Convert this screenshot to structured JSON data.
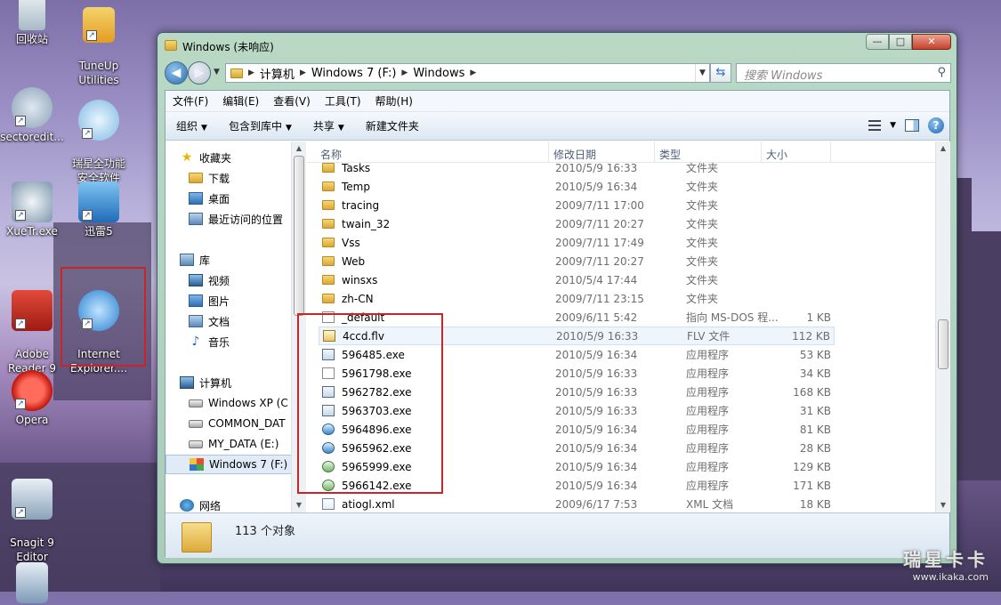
{
  "desktop": {
    "icons": [
      {
        "label": "回收站"
      },
      {
        "label": "TuneUp\nUtilities"
      },
      {
        "label": "sectoredit..."
      },
      {
        "label": "瑞星全功能\n安全软件"
      },
      {
        "label": "XueTr.exe"
      },
      {
        "label": "迅雷5"
      },
      {
        "label": "Adobe\nReader 9"
      },
      {
        "label": "Internet\nExplorer...."
      },
      {
        "label": "Opera"
      },
      {
        "label": "Snagit 9\nEditor"
      }
    ],
    "watermark": {
      "line1": "瑞星卡卡",
      "line2": "www.ikaka.com"
    }
  },
  "window": {
    "title": "Windows (未响应)",
    "buttons": {
      "minimize": "—",
      "maximize": "□",
      "close": "✕"
    }
  },
  "address": {
    "crumbs": [
      "计算机",
      "Windows 7 (F:)",
      "Windows"
    ],
    "search_placeholder": "搜索 Windows"
  },
  "menu": [
    "文件(F)",
    "编辑(E)",
    "查看(V)",
    "工具(T)",
    "帮助(H)"
  ],
  "toolbar": {
    "organize": "组织",
    "include": "包含到库中",
    "share": "共享",
    "new_folder": "新建文件夹"
  },
  "navpane": {
    "favorites": {
      "label": "收藏夹",
      "items": [
        "下载",
        "桌面",
        "最近访问的位置"
      ]
    },
    "libraries": {
      "label": "库",
      "items": [
        "视频",
        "图片",
        "文档",
        "音乐"
      ]
    },
    "computer": {
      "label": "计算机",
      "items": [
        "Windows XP (C",
        "COMMON_DAT",
        "MY_DATA (E:)",
        "Windows 7 (F:)"
      ]
    },
    "network": {
      "label": "网络"
    }
  },
  "columns": {
    "name": "名称",
    "date": "修改日期",
    "type": "类型",
    "size": "大小"
  },
  "files": [
    {
      "name": "Tasks",
      "date": "2010/5/9 16:33",
      "type": "文件夹",
      "size": "",
      "icon": "folder"
    },
    {
      "name": "Temp",
      "date": "2010/5/9 16:34",
      "type": "文件夹",
      "size": "",
      "icon": "folder"
    },
    {
      "name": "tracing",
      "date": "2009/7/11 17:00",
      "type": "文件夹",
      "size": "",
      "icon": "folder"
    },
    {
      "name": "twain_32",
      "date": "2009/7/11 20:27",
      "type": "文件夹",
      "size": "",
      "icon": "folder"
    },
    {
      "name": "Vss",
      "date": "2009/7/11 17:49",
      "type": "文件夹",
      "size": "",
      "icon": "folder"
    },
    {
      "name": "Web",
      "date": "2009/7/11 20:27",
      "type": "文件夹",
      "size": "",
      "icon": "folder"
    },
    {
      "name": "winsxs",
      "date": "2010/5/4 17:44",
      "type": "文件夹",
      "size": "",
      "icon": "folder"
    },
    {
      "name": "zh-CN",
      "date": "2009/7/11 23:15",
      "type": "文件夹",
      "size": "",
      "icon": "folder"
    },
    {
      "name": "_default",
      "date": "2009/6/11 5:42",
      "type": "指向 MS-DOS 程...",
      "size": "1 KB",
      "icon": "doc"
    },
    {
      "name": "4ccd.flv",
      "date": "2010/5/9 16:33",
      "type": "FLV 文件",
      "size": "112 KB",
      "icon": "flv"
    },
    {
      "name": "596485.exe",
      "date": "2010/5/9 16:34",
      "type": "应用程序",
      "size": "53 KB",
      "icon": "exe"
    },
    {
      "name": "5961798.exe",
      "date": "2010/5/9 16:33",
      "type": "应用程序",
      "size": "34 KB",
      "icon": "doc"
    },
    {
      "name": "5962782.exe",
      "date": "2010/5/9 16:33",
      "type": "应用程序",
      "size": "168 KB",
      "icon": "exe"
    },
    {
      "name": "5963703.exe",
      "date": "2010/5/9 16:33",
      "type": "应用程序",
      "size": "31 KB",
      "icon": "exe"
    },
    {
      "name": "5964896.exe",
      "date": "2010/5/9 16:34",
      "type": "应用程序",
      "size": "81 KB",
      "icon": "exe2"
    },
    {
      "name": "5965962.exe",
      "date": "2010/5/9 16:34",
      "type": "应用程序",
      "size": "28 KB",
      "icon": "exe2"
    },
    {
      "name": "5965999.exe",
      "date": "2010/5/9 16:34",
      "type": "应用程序",
      "size": "129 KB",
      "icon": "exe3"
    },
    {
      "name": "5966142.exe",
      "date": "2010/5/9 16:34",
      "type": "应用程序",
      "size": "171 KB",
      "icon": "exe3"
    },
    {
      "name": "atiogl.xml",
      "date": "2009/6/17 7:53",
      "type": "XML 文档",
      "size": "18 KB",
      "icon": "xml"
    }
  ],
  "status": {
    "count": "113 个对象"
  },
  "colors": {
    "highlight": "#c8242a",
    "window_frame": "#b9d9c5"
  }
}
